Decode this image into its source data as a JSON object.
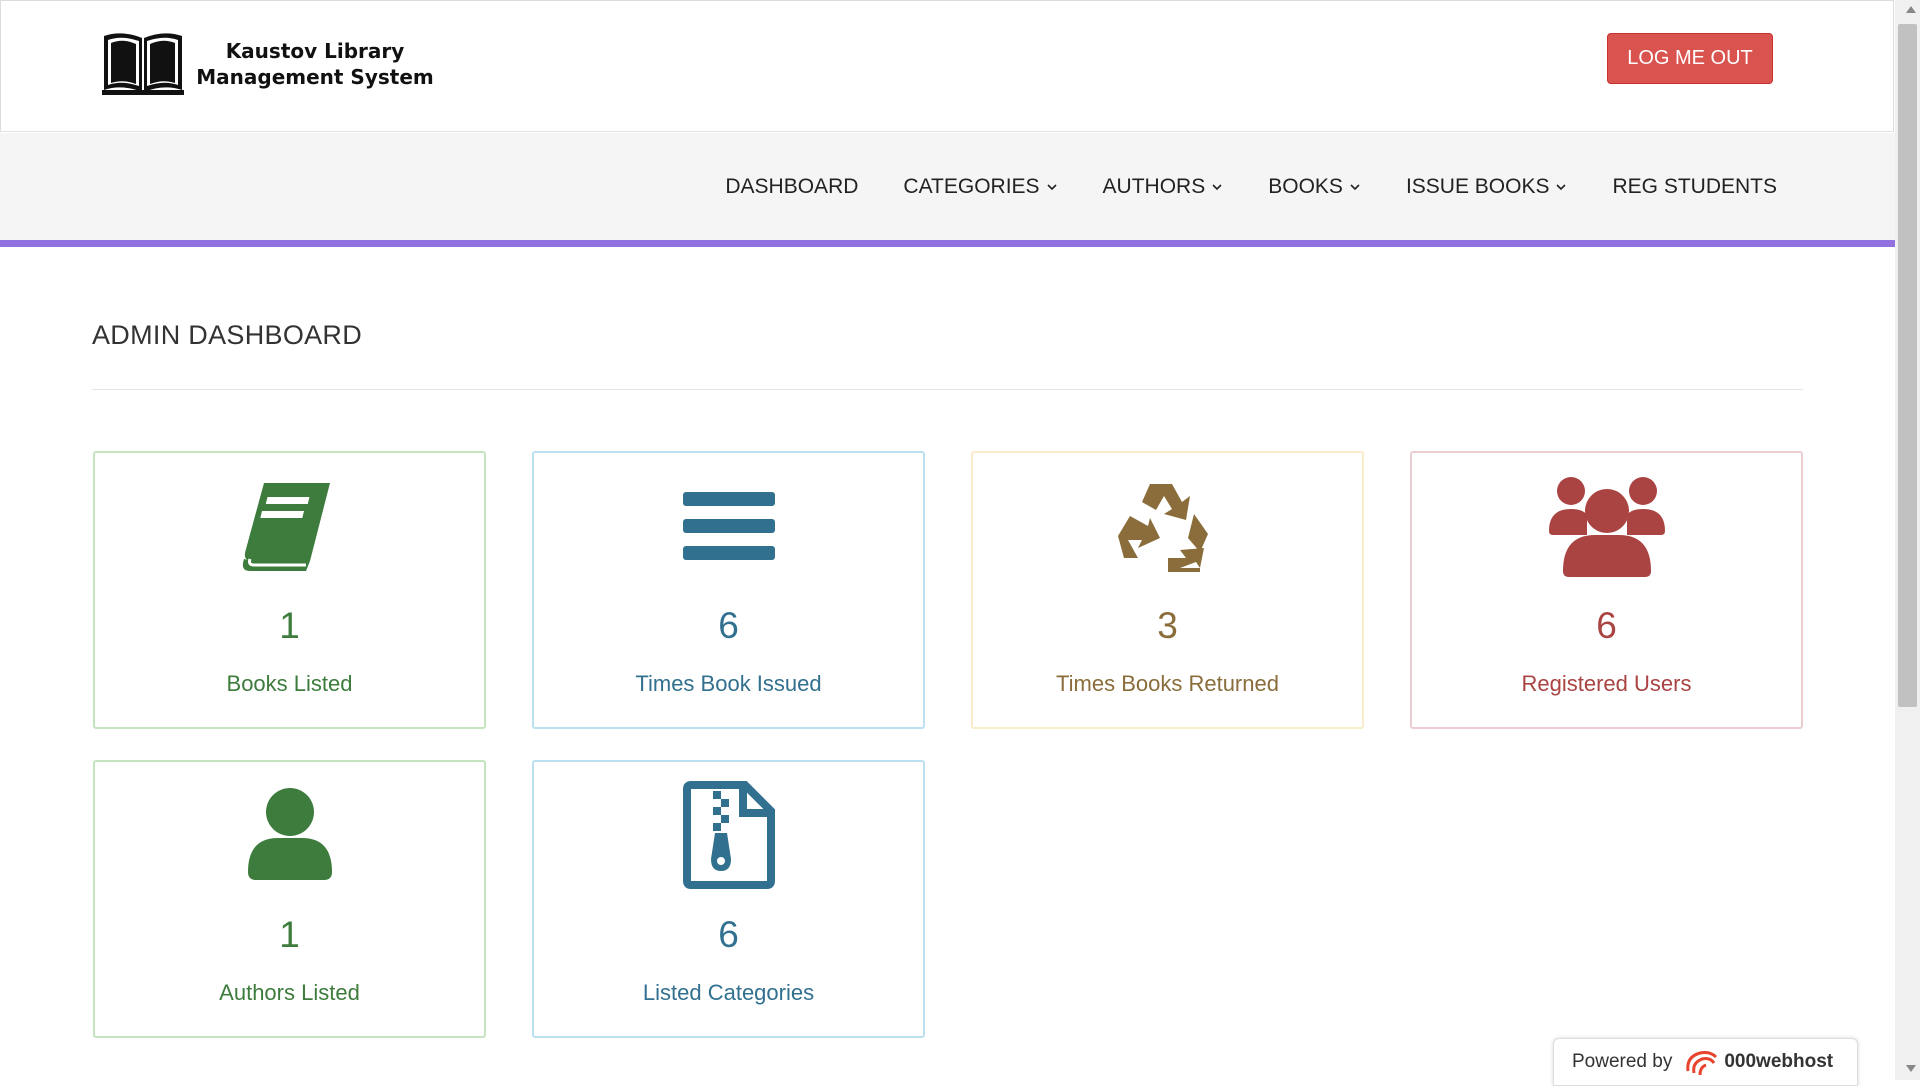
{
  "header": {
    "brand_line1": "Kaustov Library",
    "brand_line2": "Management System",
    "logout_label": "LOG ME OUT"
  },
  "nav": {
    "items": [
      {
        "label": "DASHBOARD"
      },
      {
        "label": "CATEGORIES"
      },
      {
        "label": "AUTHORS"
      },
      {
        "label": "BOOKS"
      },
      {
        "label": "ISSUE BOOKS"
      },
      {
        "label": "REG STUDENTS"
      }
    ],
    "accent_color": "#9170e0"
  },
  "main": {
    "title": "ADMIN DASHBOARD",
    "cards": [
      {
        "value": "1",
        "label": "Books Listed",
        "icon": "book-icon",
        "color": "#3d7c3d"
      },
      {
        "value": "6",
        "label": "Times Book Issued",
        "icon": "bars-icon",
        "color": "#31708f"
      },
      {
        "value": "3",
        "label": "Times Books Returned",
        "icon": "recycle-icon",
        "color": "#8a6d3b"
      },
      {
        "value": "6",
        "label": "Registered Users",
        "icon": "users-icon",
        "color": "#a94442"
      },
      {
        "value": "1",
        "label": "Authors Listed",
        "icon": "user-icon",
        "color": "#3d7c3d"
      },
      {
        "value": "6",
        "label": "Listed Categories",
        "icon": "file-zip-icon",
        "color": "#31708f"
      }
    ]
  },
  "footer_badge": {
    "prefix": "Powered by",
    "host": "000webhost"
  }
}
